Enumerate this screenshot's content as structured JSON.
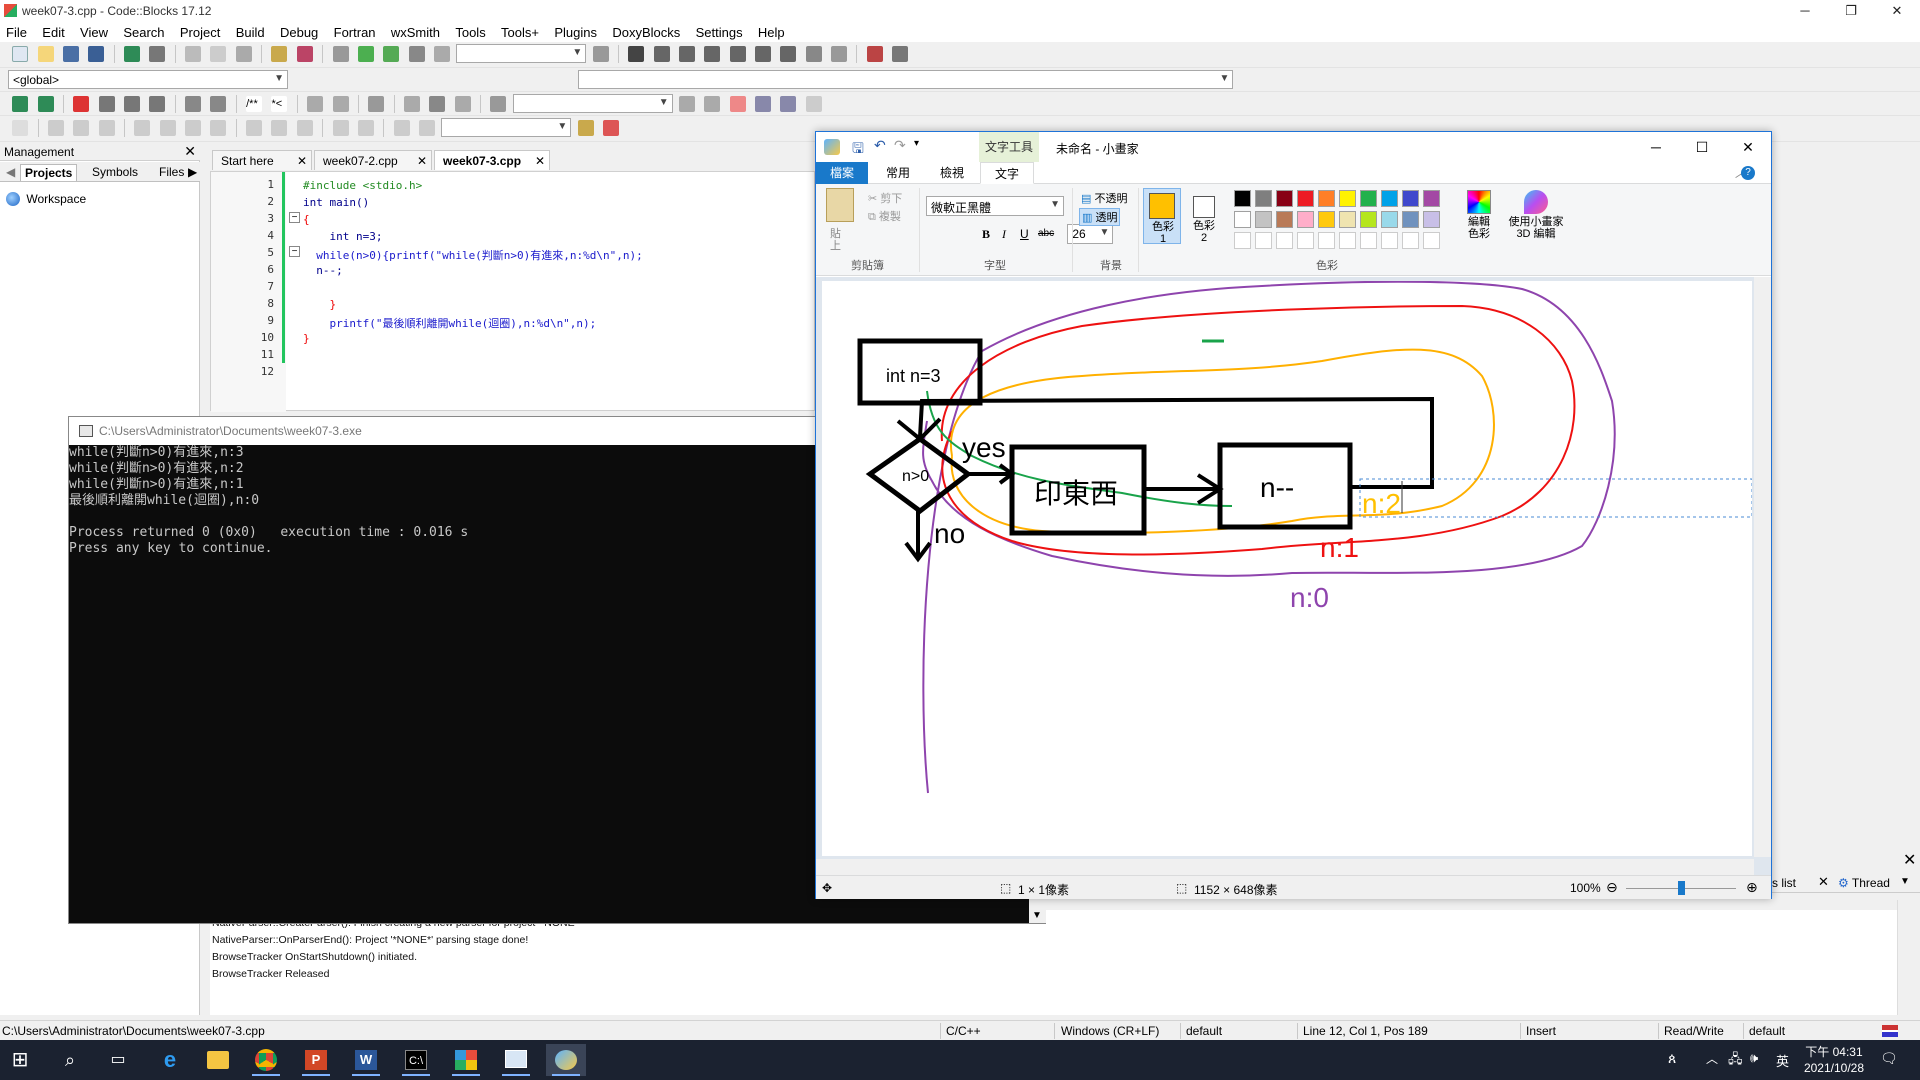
{
  "app": {
    "title": "week07-3.cpp - Code::Blocks 17.12",
    "menu": [
      "File",
      "Edit",
      "View",
      "Search",
      "Project",
      "Build",
      "Debug",
      "Fortran",
      "wxSmith",
      "Tools",
      "Tools+",
      "Plugins",
      "DoxyBlocks",
      "Settings",
      "Help"
    ],
    "scope_combo": "<global>"
  },
  "management": {
    "title": "Management",
    "tabs": [
      "Projects",
      "Symbols",
      "Files"
    ],
    "workspace": "Workspace"
  },
  "editor": {
    "tabs": [
      "Start here",
      "week07-2.cpp",
      "week07-3.cpp"
    ],
    "line_numbers": [
      "1",
      "2",
      "3",
      "4",
      "5",
      "6",
      "7",
      "8",
      "9",
      "10",
      "11",
      "12"
    ],
    "lines": [
      "#include <stdio.h>",
      "int main()",
      "{",
      "    int n=3;",
      "  while(n>0){printf(\"while(判斷n>0)有進來,n:%d\\n\",n);",
      "  n--;",
      "",
      "    }",
      "    printf(\"最後順利離開while(迴圈),n:%d\\n\",n);",
      "}",
      "",
      ""
    ]
  },
  "console": {
    "title": "C:\\Users\\Administrator\\Documents\\week07-3.exe",
    "lines": [
      "while(判斷n>0)有進來,n:3",
      "while(判斷n>0)有進來,n:2",
      "while(判斷n>0)有進來,n:1",
      "最後順利離開while(迴圈),n:0",
      "",
      "Process returned 0 (0x0)   execution time : 0.016 s",
      "Press any key to continue."
    ]
  },
  "log": {
    "lines": [
      "NativeParser::CreateParser(): Finish creating a new parser for project '*NONE*'",
      "NativeParser::OnParserEnd(): Project '*NONE*' parsing stage done!",
      "BrowseTracker OnStartShutdown() initiated.",
      "BrowseTracker Released"
    ],
    "right_tabs": [
      "s list",
      "Thread"
    ]
  },
  "statusbar": {
    "path": "C:\\Users\\Administrator\\Documents\\week07-3.cpp",
    "lang": "C/C++",
    "eol": "Windows (CR+LF)",
    "encoding": "default",
    "position": "Line 12, Col 1, Pos 189",
    "mode": "Insert",
    "access": "Read/Write",
    "extra": "default"
  },
  "paint": {
    "context_tab": "文字工具",
    "title": "未命名 - 小畫家",
    "tabs": [
      "檔案",
      "常用",
      "檢視",
      "文字"
    ],
    "clipboard": {
      "paste": "貼上",
      "cut": "剪下",
      "copy": "複製",
      "label": "剪貼簿"
    },
    "font": {
      "name": "微軟正黑體",
      "size": "26",
      "label": "字型"
    },
    "background": {
      "opaque": "不透明",
      "transparent": "透明",
      "label": "背景"
    },
    "colors": {
      "color1_label": "色彩 1",
      "color2_label": "色彩 2",
      "edit_label": "編輯色彩",
      "paint3d_label": "使用小畫家 3D 編輯",
      "label": "色彩",
      "color1": "#ffc000",
      "color2": "#ffffff",
      "palette_row1": [
        "#000000",
        "#7f7f7f",
        "#880015",
        "#ed1c24",
        "#ff7f27",
        "#fff200",
        "#22b14c",
        "#00a2e8",
        "#3f48cc",
        "#a349a4"
      ],
      "palette_row2": [
        "#ffffff",
        "#c3c3c3",
        "#b97a57",
        "#ffaec9",
        "#ffc90e",
        "#efe4b0",
        "#b5e61d",
        "#99d9ea",
        "#7092be",
        "#c8bfe7"
      ]
    },
    "drawing": {
      "box1": "int n=3",
      "diamond": "n>0",
      "yes": "yes",
      "no": "no",
      "box2": "印東西",
      "box3": "n--",
      "n2": "n:2",
      "n1": "n:1",
      "n0": "n:0"
    },
    "status": {
      "selection": "1 × 1像素",
      "canvas_size": "1152 × 648像素",
      "zoom": "100%"
    }
  },
  "taskbar": {
    "time": "下午 04:31",
    "date": "2021/10/28",
    "ime": "英"
  }
}
